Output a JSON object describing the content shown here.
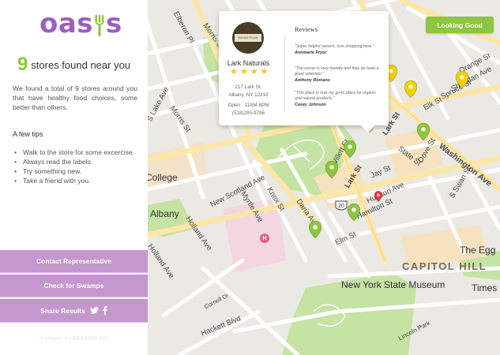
{
  "app": {
    "logo_text": "oas",
    "logo_tail": "s"
  },
  "summary": {
    "count": "9",
    "found_text": "stores found near you",
    "intro": "We found a total of 9 stores around you that have healthy food choices, some better than others."
  },
  "tips": {
    "title": "A few tips",
    "items": [
      "Walk to the store for some excercise.",
      "Always read the labels.",
      "Try something new.",
      "Take a friend with you."
    ]
  },
  "actions": {
    "contact": "Contact Representative",
    "swamps": "Check for Swamps",
    "share": "Share Results"
  },
  "footer": "A project by SEASON SIX",
  "status_button": "Looking Good",
  "popup": {
    "photo_sign": "Natural Foods",
    "store_name": "Lark Naturals",
    "rating": 4,
    "address_line1": "217 Lark St.",
    "address_line2": "Albany, NY 12210",
    "hours": "Open · 11AM-8PM",
    "phone": "(518)285-9786",
    "reviews_title": "Reviews",
    "reviews": [
      {
        "quote": "\"Super helpful owners, love shopping here.\"",
        "author": "Annmarie Pryor"
      },
      {
        "quote": "\"The owner is very friendly and they do have a great selection.\"",
        "author": "Anthony Romano"
      },
      {
        "quote": "\"This place is now my go-to place for organic and natural products.\"",
        "author": "Casey Johnson"
      }
    ]
  },
  "map": {
    "labels": {
      "elberon": "Elberon Pl",
      "morris_top": "Morris St",
      "lake_ave": "S Lake Ave",
      "morris": "Morris St",
      "college": "College",
      "albany": "f Albany",
      "new_scotland": "New Scotland Ave",
      "myrtle": "Myrtle Ave",
      "knox": "Knox St",
      "dana": "Dana Ave",
      "holland_top": "Holland Ave",
      "holland": "Holland Ave",
      "cornell": "Cornell Dr",
      "hackett": "Hackett Blvd",
      "willett": "Willett St",
      "lark": "Lark St",
      "jay": "Jay St",
      "hudson": "Hudson Ave",
      "hamilton": "Hamilton St",
      "elm": "Elm St",
      "state": "State St",
      "dove": "Dove St",
      "washington": "Washington Ave",
      "spruce": "Spruce St",
      "elk": "Elk St",
      "orange": "Orange St",
      "sheridan": "Sheridan Ave",
      "s_swan": "S Swan St",
      "the_egg": "The Egg",
      "capitol_hill": "CAPITOL HILL",
      "museum": "New York State Museum",
      "times_union": "Times Unio",
      "lincoln": "Lincoln Park",
      "route": "20",
      "hospital": "H"
    },
    "colors": {
      "store_pin": "#8dc63f",
      "top_pin": "#f0d000",
      "user_pin": "#e53935",
      "park": "#c5e3a3",
      "hospital_area": "#f4d6e0",
      "main_road": "#fde7a8",
      "accent_purple": "#9b5fc0",
      "button_purple": "#c597cf"
    },
    "pins": [
      {
        "name": "map-pin-store-1",
        "kind": "store"
      },
      {
        "name": "map-pin-store-2",
        "kind": "store"
      },
      {
        "name": "map-pin-store-3",
        "kind": "store"
      },
      {
        "name": "map-pin-store-4",
        "kind": "store"
      },
      {
        "name": "map-pin-store-5",
        "kind": "store"
      },
      {
        "name": "map-pin-store-6",
        "kind": "store"
      },
      {
        "name": "map-pin-top-1",
        "kind": "top"
      },
      {
        "name": "map-pin-top-2",
        "kind": "top"
      },
      {
        "name": "map-pin-top-3",
        "kind": "top"
      },
      {
        "name": "map-pin-user",
        "kind": "user"
      }
    ]
  }
}
